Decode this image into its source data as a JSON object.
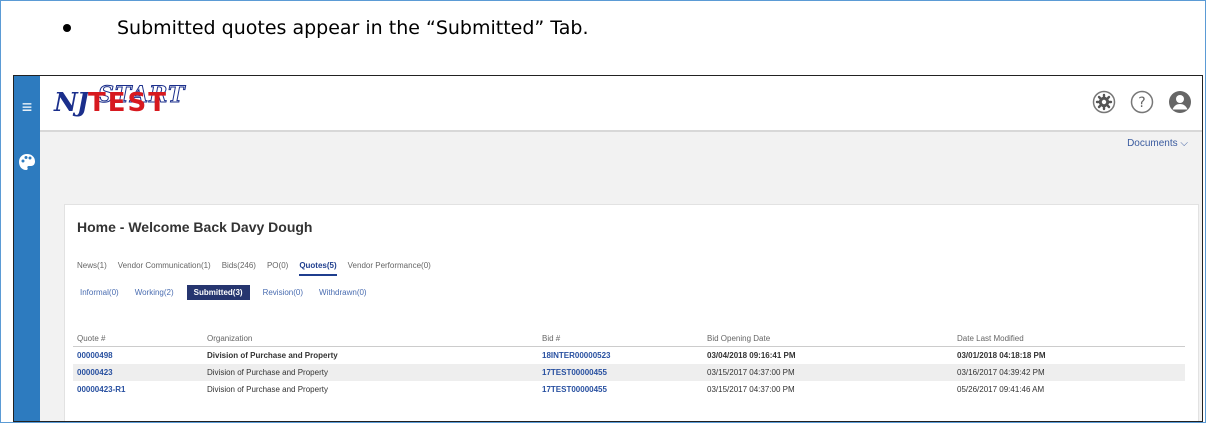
{
  "caption": {
    "text": "Submitted quotes appear in the “Submitted” Tab."
  },
  "icons": {
    "menu": "hamburger-icon",
    "palette": "palette-icon",
    "settings": "gear-icon",
    "help": "help-icon",
    "user": "user-icon"
  },
  "header": {
    "logo_text_top": "NJSTART",
    "logo_text_overlay": "TEST",
    "documents_label": "Documents ⌵"
  },
  "colors": {
    "rail": "#2d7bbf",
    "active_subtab": "#26356f",
    "link": "#2850a0",
    "logo_red": "#d7191f",
    "logo_blue": "#1b2f8c"
  },
  "main": {
    "title": "Home - Welcome Back Davy Dough",
    "tabs": [
      {
        "label": "News(1)"
      },
      {
        "label": "Vendor Communication(1)"
      },
      {
        "label": "Bids(246)"
      },
      {
        "label": "PO(0)"
      },
      {
        "label": "Quotes(5)",
        "active": true
      },
      {
        "label": "Vendor Performance(0)"
      }
    ],
    "subtabs": [
      {
        "label": "Informal(0)"
      },
      {
        "label": "Working(2)"
      },
      {
        "label": "Submitted(3)",
        "active": true
      },
      {
        "label": "Revision(0)"
      },
      {
        "label": "Withdrawn(0)"
      }
    ],
    "table": {
      "columns": [
        "Quote #",
        "Organization",
        "Bid #",
        "Bid Opening Date",
        "Date Last Modified"
      ],
      "rows": [
        [
          "00000498",
          "Division of Purchase and Property",
          "18INTER00000523",
          "03/04/2018 09:16:41 PM",
          "03/01/2018 04:18:18 PM"
        ],
        [
          "00000423",
          "Division of Purchase and Property",
          "17TEST00000455",
          "03/15/2017 04:37:00 PM",
          "03/16/2017 04:39:42 PM"
        ],
        [
          "00000423-R1",
          "Division of Purchase and Property",
          "17TEST00000455",
          "03/15/2017 04:37:00 PM",
          "05/26/2017 09:41:46 AM"
        ]
      ]
    }
  }
}
